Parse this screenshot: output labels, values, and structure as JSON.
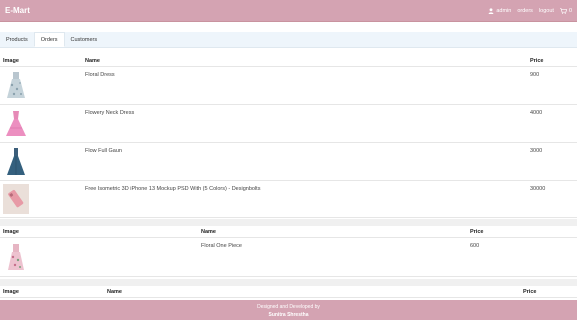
{
  "nav": {
    "brand": "E-Mart",
    "user_label": "admin",
    "orders_label": "orders",
    "logout_label": "logout",
    "cart_count": "0"
  },
  "tabs": [
    {
      "label": "Products"
    },
    {
      "label": "Orders"
    },
    {
      "label": "Customers"
    }
  ],
  "orders": [
    {
      "headers": {
        "image": "Image",
        "name": "Name",
        "price": "Price"
      },
      "items": [
        {
          "name": "Floral Dress",
          "price": "900",
          "image_icon": "floral-dress-image"
        },
        {
          "name": "Flowery Neck Dress",
          "price": "4000",
          "image_icon": "pink-dress-image"
        },
        {
          "name": "Flow Full Gaun",
          "price": "3000",
          "image_icon": "blue-gown-image"
        },
        {
          "name": "Free Isometric 3D iPhone 13 Mockup PSD With (5 Colors) - Designbolts",
          "price": "30000",
          "image_icon": "phone-mockup-image"
        }
      ]
    },
    {
      "headers": {
        "image": "Image",
        "name": "Name",
        "price": "Price"
      },
      "items": [
        {
          "name": "Floral One Piece",
          "price": "600",
          "image_icon": "floral-one-piece-image"
        }
      ]
    },
    {
      "headers": {
        "image": "Image",
        "name": "Name",
        "price": "Price"
      },
      "items": []
    }
  ],
  "footer": {
    "line1": "Designed and Developed by",
    "line2": "Sunitra Shrestha"
  },
  "colors": {
    "brand": "#d4a3b2",
    "tabs_bg": "#eef5fb"
  }
}
